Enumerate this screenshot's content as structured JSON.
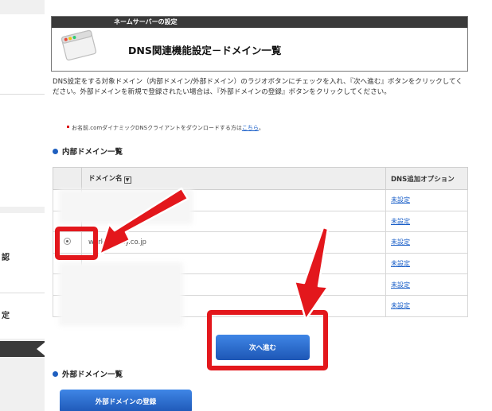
{
  "sidebar": {
    "items": [
      {
        "label": "認"
      },
      {
        "label": "定"
      }
    ]
  },
  "header": {
    "category": "ネームサーバーの設定",
    "title": "DNS関連機能設定－ドメイン一覧"
  },
  "description": "DNS設定をする対象ドメイン（内部ドメイン/外部ドメイン）のラジオボタンにチェックを入れ、『次へ進む』ボタンをクリックしてください。外部ドメインを新規で登録されたい場合は、『外部ドメインの登録』ボタンをクリックしてください。",
  "note": {
    "text": "お名前.comダイナミックDNSクライアントをダウンロードする方は",
    "link": "こちら",
    "suffix": "。"
  },
  "internal": {
    "heading": "内部ドメイン一覧",
    "columns": {
      "domain": "ドメイン名",
      "sort": "▼",
      "option": "DNS追加オプション"
    },
    "rows": [
      {
        "domain": "",
        "option": "未設定"
      },
      {
        "domain": "",
        "option": "未設定"
      },
      {
        "domain": "workspeedy.co.jp",
        "option": "未設定",
        "selected": true
      },
      {
        "domain": "",
        "option": "未設定"
      },
      {
        "domain": "",
        "option": "未設定"
      },
      {
        "domain": "",
        "option": "未設定"
      }
    ]
  },
  "buttons": {
    "next": "次へ進む",
    "register_external": "外部ドメインの登録"
  },
  "external": {
    "heading": "外部ドメイン一覧"
  },
  "colors": {
    "highlight": "#e3171c",
    "button": "#1d56b5",
    "header_bar": "#3a3a3a",
    "link": "#1a5fc8"
  }
}
